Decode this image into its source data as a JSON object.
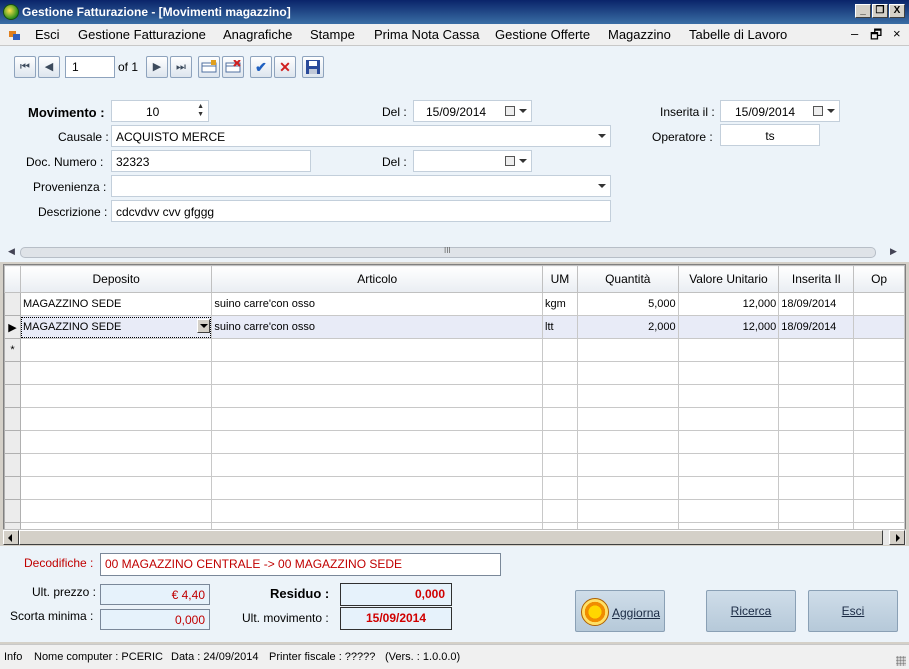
{
  "window": {
    "title": "Gestione Fatturazione - [Movimenti magazzino]",
    "controls": {
      "minimize": "_",
      "restore": "❐",
      "close": "X"
    }
  },
  "menu": {
    "items": [
      "Esci",
      "Gestione Fatturazione",
      "Anagrafiche",
      "Stampe",
      "Prima Nota Cassa",
      "Gestione Offerte",
      "Magazzino",
      "Tabelle di Lavoro"
    ],
    "mdi_controls": [
      "–",
      "🗗",
      "×"
    ]
  },
  "navigator": {
    "position": "1",
    "of_text": "of 1"
  },
  "form": {
    "movimento": {
      "label": "Movimento :",
      "value": "10"
    },
    "del1": {
      "label": "Del :",
      "value": "15/09/2014"
    },
    "inserita": {
      "label": "Inserita il :",
      "value": "15/09/2014"
    },
    "causale": {
      "label": "Causale :",
      "value": "ACQUISTO MERCE"
    },
    "operatore": {
      "label": "Operatore :",
      "value": "ts"
    },
    "doc_numero": {
      "label": "Doc. Numero :",
      "value": "32323"
    },
    "del2": {
      "label": "Del :",
      "value": ""
    },
    "provenienza": {
      "label": "Provenienza :",
      "value": ""
    },
    "descrizione": {
      "label": "Descrizione :",
      "value": "cdcvdvv cvv   gfggg"
    }
  },
  "grid": {
    "columns": [
      "Deposito",
      "Articolo",
      "UM",
      "Quantità",
      "Valore Unitario",
      "Inserita Il",
      "Op"
    ],
    "rows": [
      {
        "marker": "",
        "deposito": "MAGAZZINO SEDE",
        "articolo": "suino carre'con osso",
        "um": "kgm",
        "quantita": "5,000",
        "valore": "12,000",
        "inserita": "18/09/2014",
        "op": ""
      },
      {
        "marker": "▶",
        "deposito": "MAGAZZINO SEDE",
        "articolo": "suino carre'con osso",
        "um": "ltt",
        "quantita": "2,000",
        "valore": "12,000",
        "inserita": "18/09/2014",
        "op": ""
      },
      {
        "marker": "*",
        "deposito": "",
        "articolo": "",
        "um": "",
        "quantita": "",
        "valore": "",
        "inserita": "",
        "op": ""
      }
    ]
  },
  "bottom": {
    "decodifiche": {
      "label": "Decodifiche :",
      "value": "00 MAGAZZINO CENTRALE  ->  00 MAGAZZINO SEDE"
    },
    "ult_prezzo": {
      "label": "Ult. prezzo :",
      "value": "€ 4,40"
    },
    "scorta_minima": {
      "label": "Scorta minima :",
      "value": "0,000"
    },
    "residuo": {
      "label": "Residuo :",
      "value": "0,000"
    },
    "ult_movimento": {
      "label": "Ult. movimento :",
      "value": "15/09/2014"
    },
    "buttons": {
      "aggiorna": "Aggiorna",
      "ricerca": "Ricerca",
      "esci": "Esci"
    }
  },
  "status": {
    "info": "Info",
    "computer": "Nome computer : PCERIC",
    "data": "Data : 24/09/2014",
    "printer": "Printer fiscale : ?????",
    "version": "(Vers. :  1.0.0.0)"
  },
  "colors": {
    "titlebar": "#0a246a",
    "form_bg": "#ecf3f9",
    "accent_red": "#c00000"
  }
}
